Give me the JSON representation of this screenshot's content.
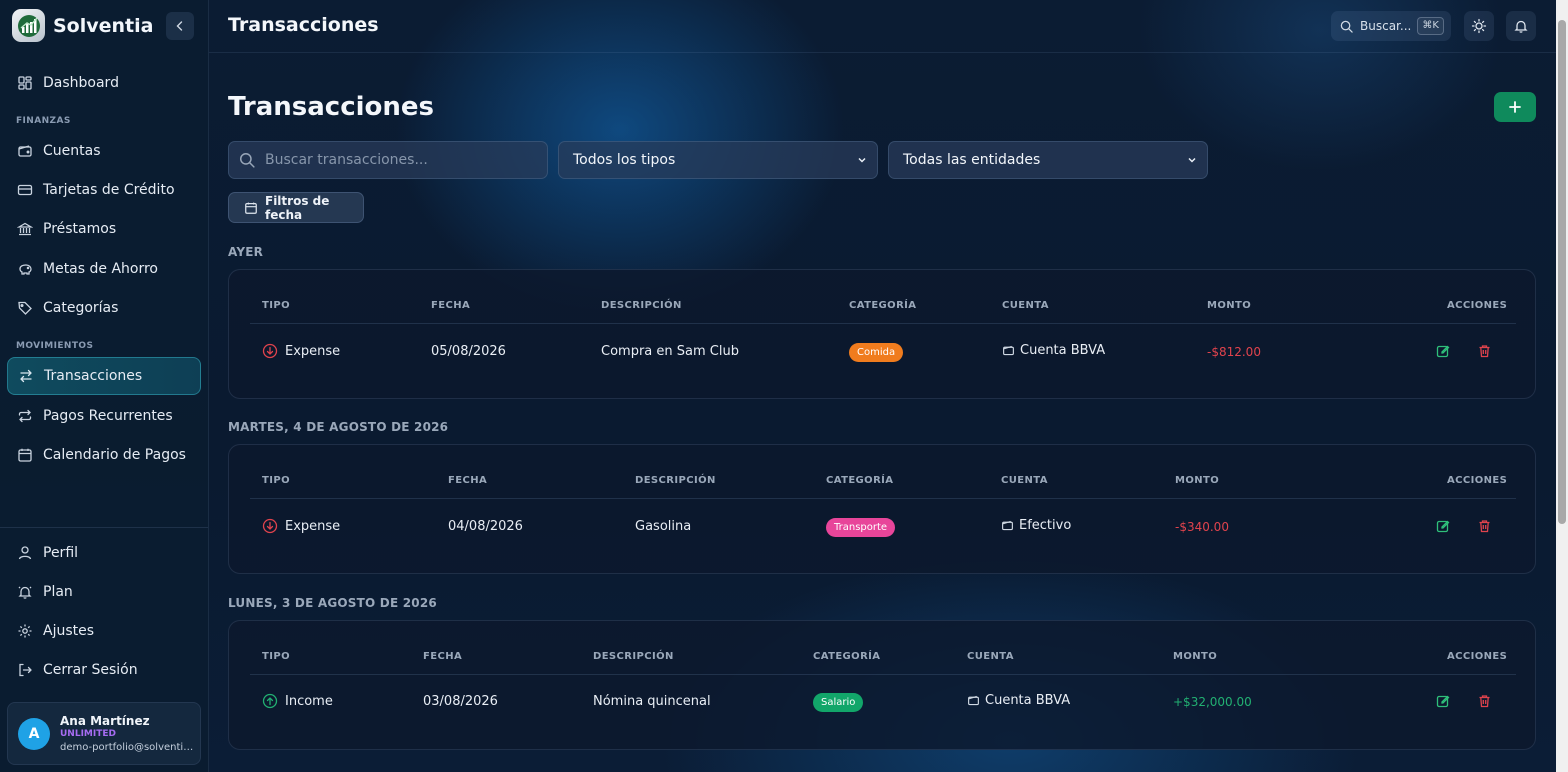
{
  "app": {
    "name": "Solventia"
  },
  "header": {
    "title": "Transacciones",
    "search_label": "Buscar...",
    "shortcut": "⌘K"
  },
  "sidebar": {
    "items_top": [
      {
        "label": "Dashboard",
        "icon": "dashboard-icon"
      }
    ],
    "sections": [
      {
        "label": "FINANZAS",
        "items": [
          {
            "label": "Cuentas",
            "icon": "wallet-icon"
          },
          {
            "label": "Tarjetas de Crédito",
            "icon": "credit-card-icon"
          },
          {
            "label": "Préstamos",
            "icon": "bank-icon"
          },
          {
            "label": "Metas de Ahorro",
            "icon": "piggy-bank-icon"
          },
          {
            "label": "Categorías",
            "icon": "tag-icon"
          }
        ]
      },
      {
        "label": "MOVIMIENTOS",
        "items": [
          {
            "label": "Transacciones",
            "icon": "arrows-left-right-icon",
            "active": true
          },
          {
            "label": "Pagos Recurrentes",
            "icon": "repeat-icon"
          },
          {
            "label": "Calendario de Pagos",
            "icon": "calendar-icon"
          }
        ]
      }
    ],
    "bottom_items": [
      {
        "label": "Perfil",
        "icon": "user-icon"
      },
      {
        "label": "Plan",
        "icon": "bell-ring-icon"
      },
      {
        "label": "Ajustes",
        "icon": "gear-icon"
      },
      {
        "label": "Cerrar Sesión",
        "icon": "logout-icon"
      }
    ],
    "user": {
      "initial": "A",
      "name": "Ana Martínez",
      "plan": "UNLIMITED",
      "email": "demo-portfolio@solventia..."
    }
  },
  "main": {
    "title": "Transacciones",
    "search_placeholder": "Buscar transacciones...",
    "type_filter": "Todos los tipos",
    "entity_filter": "Todas las entidades",
    "date_filter_label": "Filtros de fecha",
    "columns": [
      "TIPO",
      "FECHA",
      "DESCRIPCIÓN",
      "CATEGORÍA",
      "CUENTA",
      "MONTO",
      "ACCIONES"
    ],
    "groups": [
      {
        "label": "AYER",
        "rows": [
          {
            "tipo": "Expense",
            "fecha": "05/08/2026",
            "descripcion": "Compra en Sam Club",
            "categoria": "Comida",
            "categoria_color": "#f07c1e",
            "cuenta": "Cuenta BBVA",
            "monto": "-$812.00",
            "monto_color": "#e0434d"
          }
        ]
      },
      {
        "label": "MARTES, 4 DE AGOSTO DE 2026",
        "rows": [
          {
            "tipo": "Expense",
            "fecha": "04/08/2026",
            "descripcion": "Gasolina",
            "categoria": "Transporte",
            "categoria_color": "#e8459a",
            "cuenta": "Efectivo",
            "monto": "-$340.00",
            "monto_color": "#e0434d"
          }
        ]
      },
      {
        "label": "LUNES, 3 DE AGOSTO DE 2026",
        "rows": [
          {
            "tipo": "Income",
            "fecha": "03/08/2026",
            "descripcion": "Nómina quincenal",
            "categoria": "Salario",
            "categoria_color": "#12a66a",
            "cuenta": "Cuenta BBVA",
            "monto": "+$32,000.00",
            "monto_color": "#22b072"
          }
        ]
      }
    ]
  },
  "colors": {
    "accent": "#0f8a5c",
    "expense": "#e0434d",
    "income": "#22b072",
    "edit": "#2fbf7a",
    "delete": "#e0434d"
  }
}
